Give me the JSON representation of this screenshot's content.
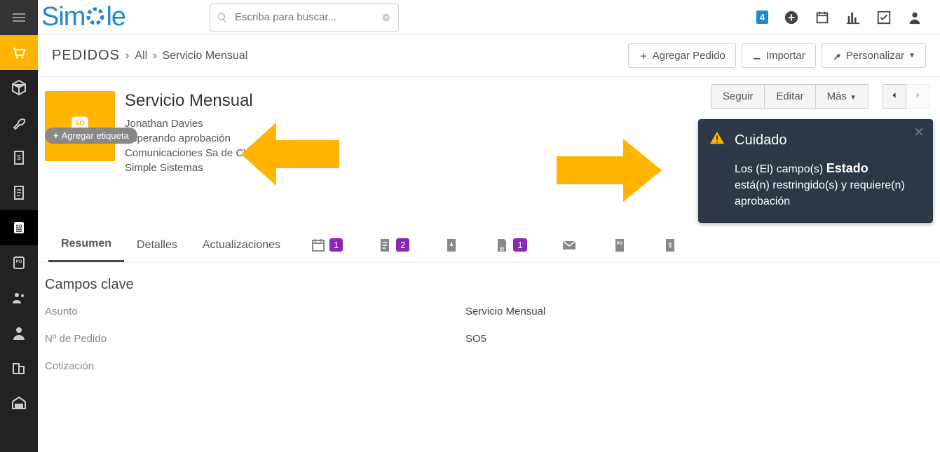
{
  "topbar": {
    "logo": "Simple",
    "search_placeholder": "Escriba para buscar...",
    "notification_count": "4"
  },
  "subheader": {
    "module": "Pedidos",
    "crumb1": "All",
    "crumb2": "Servicio Mensual",
    "btn_add": "Agregar Pedido",
    "btn_import": "Importar",
    "btn_customize": "Personalizar"
  },
  "record": {
    "title": "Servicio Mensual",
    "owner": "Jonathan Davies",
    "status": "Esperando aprobación",
    "account": "Comunicaciones Sa de CV",
    "company": "Simple Sistemas",
    "tag_btn": "Agregar etiqueta",
    "btn_follow": "Seguir",
    "btn_edit": "Editar",
    "btn_more": "Más"
  },
  "tabs": {
    "summary": "Resumen",
    "details": "Detalles",
    "updates": "Actualizaciones",
    "badge_cal": "1",
    "badge_notes": "2",
    "badge_docs": "1"
  },
  "keyfields": {
    "heading": "Campos clave",
    "subject_label": "Asunto",
    "subject_value": "Servicio Mensual",
    "number_label": "Nº de Pedido",
    "number_value": "SO5",
    "quote_label": "Cotización"
  },
  "toast": {
    "title": "Cuidado",
    "pre": "Los (El) campo(s) ",
    "field": "Estado",
    "post": " está(n) restringido(s) y requiere(n) aprobación"
  }
}
